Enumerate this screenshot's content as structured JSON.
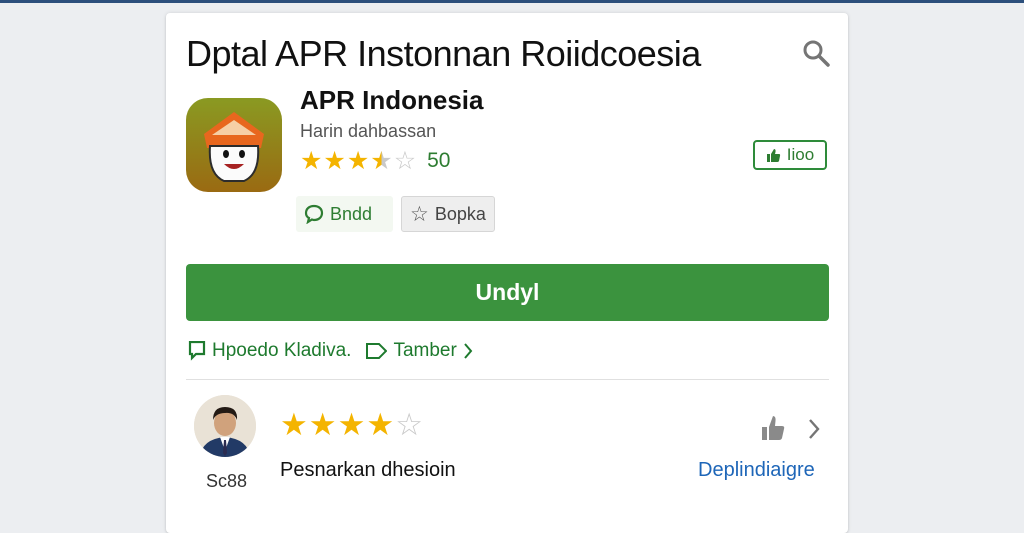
{
  "page": {
    "title": "Dptal  APR Instonnan Roiidcoesia"
  },
  "icons": {
    "search": "search-icon",
    "app": "app-mascot-icon",
    "share": "chat-bubble-icon",
    "wishlist": "star-outline-icon",
    "tag": "thumb-up-icon",
    "report": "flag-icon",
    "tag_label": "tag-icon",
    "helpful": "thumb-up-outline-icon",
    "more": "chevron-right-icon"
  },
  "app": {
    "name": "APR Indonesia",
    "subtitle": "Harin dahbassan",
    "rating_stars": 3.5,
    "rating_count": "50",
    "tag_label": "Iioo",
    "share_label": "Bndd",
    "wishlist_label": "Bopka",
    "install_label": "Undyl"
  },
  "links": {
    "report": "Hpoedo Kladiva.",
    "add": "Tamber"
  },
  "review": {
    "reviewer_name": "Sc88",
    "stars": 4,
    "text": "Pesnarkan dhesioin",
    "more_label": "Deplindiaigre"
  },
  "colors": {
    "accent_green": "#3b933e",
    "link_green": "#1e7a2e",
    "star_yellow": "#f4b400",
    "link_blue": "#1e66b8",
    "top_bar": "#2c4f7c",
    "background": "#eceef1"
  }
}
